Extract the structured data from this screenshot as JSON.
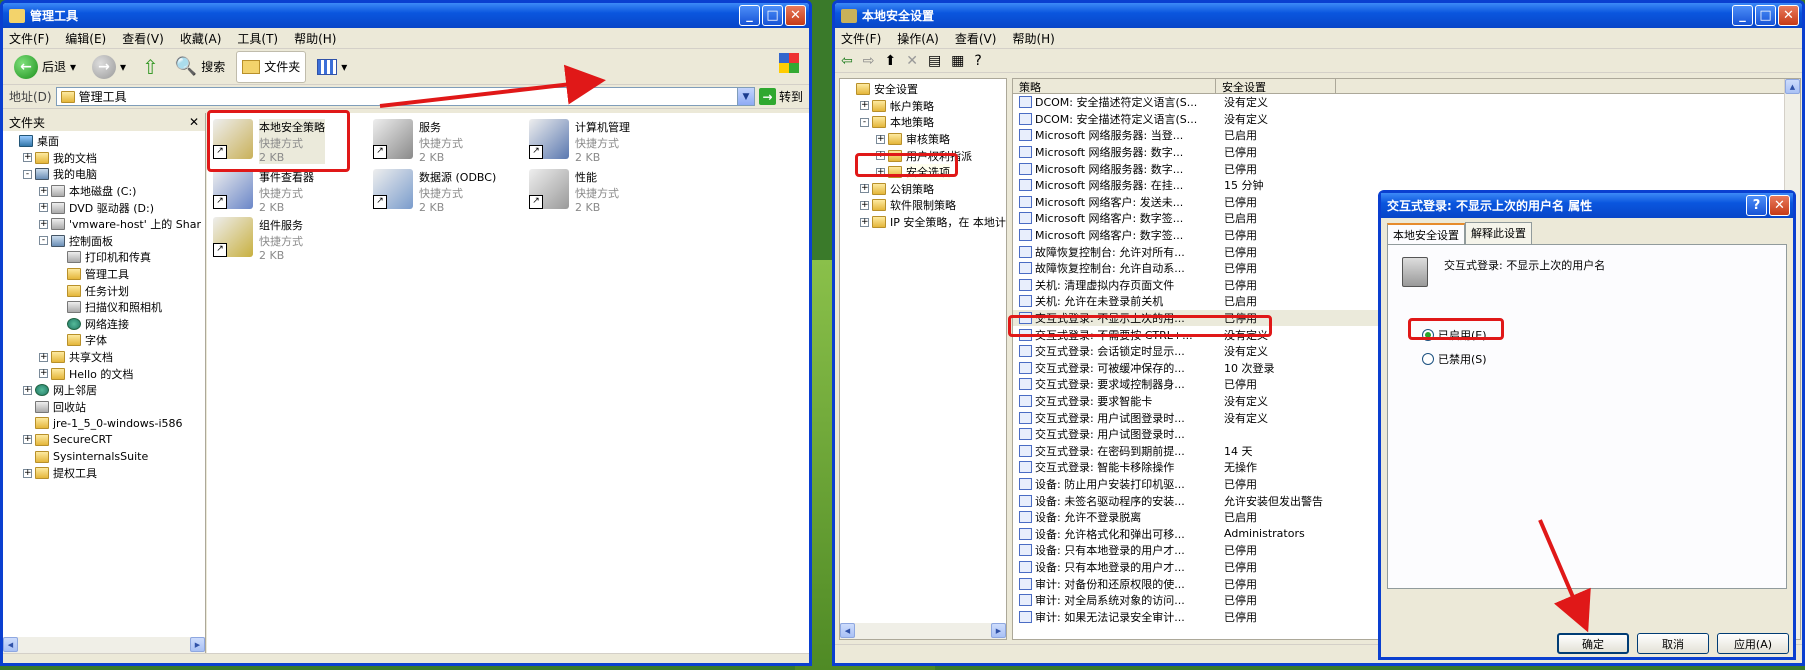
{
  "left": {
    "title": "管理工具",
    "menu": [
      "文件(F)",
      "编辑(E)",
      "查看(V)",
      "收藏(A)",
      "工具(T)",
      "帮助(H)"
    ],
    "toolbar": {
      "back": "后退",
      "search": "搜索",
      "folders": "文件夹"
    },
    "address": {
      "label": "地址(D)",
      "value": "管理工具",
      "go": "转到"
    },
    "folders_title": "文件夹",
    "tree": [
      {
        "label": "桌面",
        "indent": 0,
        "icon": "desktop-icon",
        "exp": ""
      },
      {
        "label": "我的文档",
        "indent": 1,
        "icon": "folder-icon",
        "exp": "+"
      },
      {
        "label": "我的电脑",
        "indent": 1,
        "icon": "computer-icon",
        "exp": "-"
      },
      {
        "label": "本地磁盘 (C:)",
        "indent": 2,
        "icon": "drive-icon",
        "exp": "+"
      },
      {
        "label": "DVD 驱动器 (D:)",
        "indent": 2,
        "icon": "drive-icon",
        "exp": "+"
      },
      {
        "label": "'vmware-host' 上的 Shar",
        "indent": 2,
        "icon": "network-drive-icon",
        "exp": "+"
      },
      {
        "label": "控制面板",
        "indent": 2,
        "icon": "control-panel-icon",
        "exp": "-"
      },
      {
        "label": "打印机和传真",
        "indent": 3,
        "icon": "printer-icon",
        "exp": ""
      },
      {
        "label": "管理工具",
        "indent": 3,
        "icon": "folder-icon",
        "exp": ""
      },
      {
        "label": "任务计划",
        "indent": 3,
        "icon": "folder-icon",
        "exp": ""
      },
      {
        "label": "扫描仪和照相机",
        "indent": 3,
        "icon": "camera-icon",
        "exp": ""
      },
      {
        "label": "网络连接",
        "indent": 3,
        "icon": "network-icon",
        "exp": ""
      },
      {
        "label": "字体",
        "indent": 3,
        "icon": "folder-icon",
        "exp": ""
      },
      {
        "label": "共享文档",
        "indent": 2,
        "icon": "folder-icon",
        "exp": "+"
      },
      {
        "label": "Hello 的文档",
        "indent": 2,
        "icon": "folder-icon",
        "exp": "+"
      },
      {
        "label": "网上邻居",
        "indent": 1,
        "icon": "network-icon",
        "exp": "+"
      },
      {
        "label": "回收站",
        "indent": 1,
        "icon": "recycle-bin-icon",
        "exp": ""
      },
      {
        "label": "jre-1_5_0-windows-i586",
        "indent": 1,
        "icon": "folder-icon",
        "exp": ""
      },
      {
        "label": "SecureCRT",
        "indent": 1,
        "icon": "folder-icon",
        "exp": "+"
      },
      {
        "label": "SysinternalsSuite",
        "indent": 1,
        "icon": "folder-icon",
        "exp": ""
      },
      {
        "label": "提权工具",
        "indent": 1,
        "icon": "folder-icon",
        "exp": "+"
      }
    ],
    "items": [
      {
        "name": "本地安全策略",
        "type": "快捷方式",
        "size": "2 KB",
        "icon": "security-policy-icon",
        "color": "#c9b15a"
      },
      {
        "name": "服务",
        "type": "快捷方式",
        "size": "2 KB",
        "icon": "services-icon",
        "color": "#8a8a8a"
      },
      {
        "name": "计算机管理",
        "type": "快捷方式",
        "size": "2 KB",
        "icon": "computer-management-icon",
        "color": "#5a78b0"
      },
      {
        "name": "事件查看器",
        "type": "快捷方式",
        "size": "2 KB",
        "icon": "event-viewer-icon",
        "color": "#6a86c8"
      },
      {
        "name": "数据源 (ODBC)",
        "type": "快捷方式",
        "size": "2 KB",
        "icon": "odbc-icon",
        "color": "#7a9ccc"
      },
      {
        "name": "性能",
        "type": "快捷方式",
        "size": "2 KB",
        "icon": "performance-icon",
        "color": "#9a9a9a"
      },
      {
        "name": "组件服务",
        "type": "快捷方式",
        "size": "2 KB",
        "icon": "component-services-icon",
        "color": "#c8b040"
      }
    ]
  },
  "right": {
    "title": "本地安全设置",
    "menu": [
      "文件(F)",
      "操作(A)",
      "查看(V)",
      "帮助(H)"
    ],
    "tree": [
      {
        "label": "安全设置",
        "indent": 0,
        "exp": ""
      },
      {
        "label": "帐户策略",
        "indent": 1,
        "exp": "+"
      },
      {
        "label": "本地策略",
        "indent": 1,
        "exp": "-"
      },
      {
        "label": "审核策略",
        "indent": 2,
        "exp": "+"
      },
      {
        "label": "用户权利指派",
        "indent": 2,
        "exp": "+"
      },
      {
        "label": "安全选项",
        "indent": 2,
        "exp": "+"
      },
      {
        "label": "公钥策略",
        "indent": 1,
        "exp": "+"
      },
      {
        "label": "软件限制策略",
        "indent": 1,
        "exp": "+"
      },
      {
        "label": "IP 安全策略，在 本地计",
        "indent": 1,
        "exp": "+"
      }
    ],
    "columns": [
      "策略",
      "安全设置"
    ],
    "policies": [
      [
        "DCOM: 安全描述符定义语言(S...",
        "没有定义"
      ],
      [
        "DCOM: 安全描述符定义语言(S...",
        "没有定义"
      ],
      [
        "Microsoft 网络服务器: 当登...",
        "已启用"
      ],
      [
        "Microsoft 网络服务器: 数字...",
        "已停用"
      ],
      [
        "Microsoft 网络服务器: 数字...",
        "已停用"
      ],
      [
        "Microsoft 网络服务器: 在挂...",
        "15 分钟"
      ],
      [
        "Microsoft 网络客户: 发送未...",
        "已停用"
      ],
      [
        "Microsoft 网络客户: 数字签...",
        "已启用"
      ],
      [
        "Microsoft 网络客户: 数字签...",
        "已停用"
      ],
      [
        "故障恢复控制台: 允许对所有...",
        "已停用"
      ],
      [
        "故障恢复控制台: 允许自动系...",
        "已停用"
      ],
      [
        "关机: 清理虚拟内存页面文件",
        "已停用"
      ],
      [
        "关机: 允许在未登录前关机",
        "已启用"
      ],
      [
        "交互式登录: 不显示上次的用...",
        "已停用"
      ],
      [
        "交互式登录: 不需要按 CTRL+...",
        "没有定义"
      ],
      [
        "交互式登录: 会话锁定时显示...",
        "没有定义"
      ],
      [
        "交互式登录: 可被缓冲保存的...",
        "10 次登录"
      ],
      [
        "交互式登录: 要求域控制器身...",
        "已停用"
      ],
      [
        "交互式登录: 要求智能卡",
        "没有定义"
      ],
      [
        "交互式登录: 用户试图登录时...",
        "没有定义"
      ],
      [
        "交互式登录: 用户试图登录时...",
        ""
      ],
      [
        "交互式登录: 在密码到期前提...",
        "14 天"
      ],
      [
        "交互式登录: 智能卡移除操作",
        "无操作"
      ],
      [
        "设备: 防止用户安装打印机驱...",
        "已停用"
      ],
      [
        "设备: 未签名驱动程序的安装...",
        "允许安装但发出警告"
      ],
      [
        "设备: 允许不登录脱离",
        "已启用"
      ],
      [
        "设备: 允许格式化和弹出可移...",
        "Administrators"
      ],
      [
        "设备: 只有本地登录的用户才...",
        "已停用"
      ],
      [
        "设备: 只有本地登录的用户才...",
        "已停用"
      ],
      [
        "审计: 对备份和还原权限的使...",
        "已停用"
      ],
      [
        "审计: 对全局系统对象的访问...",
        "已停用"
      ],
      [
        "审计: 如果无法记录安全审计...",
        "已停用"
      ]
    ]
  },
  "dialog": {
    "title": "交互式登录: 不显示上次的用户名 属性",
    "tabs": [
      "本地安全设置",
      "解释此设置"
    ],
    "heading": "交互式登录: 不显示上次的用户名",
    "enabled": "已启用(E)",
    "disabled": "已禁用(S)",
    "ok": "确定",
    "cancel": "取消",
    "apply": "应用(A)"
  }
}
